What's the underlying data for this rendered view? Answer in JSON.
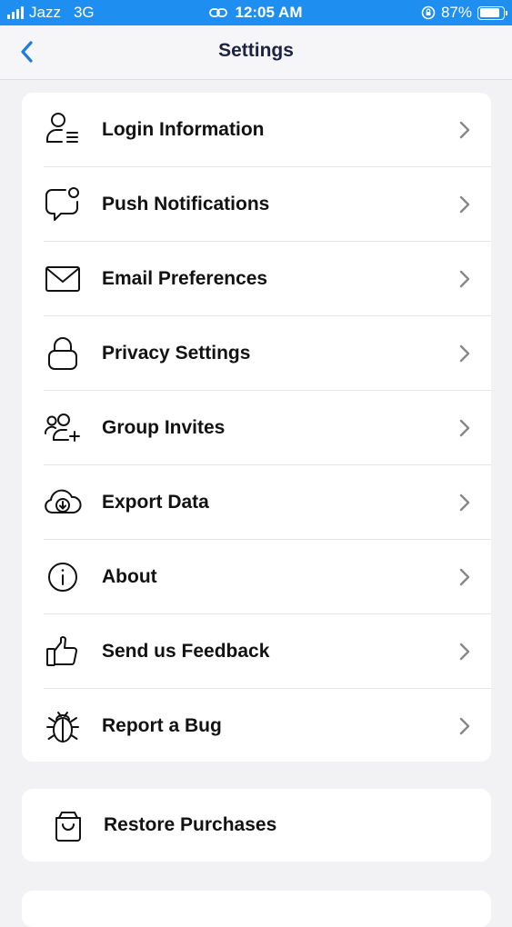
{
  "status_bar": {
    "carrier": "Jazz",
    "network": "3G",
    "time": "12:05 AM",
    "battery": "87%",
    "battery_level": 0.87
  },
  "header": {
    "title": "Settings",
    "back_icon": "chevron-left-icon"
  },
  "menu": {
    "items": [
      {
        "label": "Login Information",
        "icon": "user-list-icon"
      },
      {
        "label": "Push Notifications",
        "icon": "chat-bubble-dot-icon"
      },
      {
        "label": "Email Preferences",
        "icon": "envelope-icon"
      },
      {
        "label": "Privacy Settings",
        "icon": "lock-icon"
      },
      {
        "label": "Group Invites",
        "icon": "user-group-add-icon"
      },
      {
        "label": "Export Data",
        "icon": "cloud-download-icon"
      },
      {
        "label": "About",
        "icon": "info-icon"
      },
      {
        "label": "Send us Feedback",
        "icon": "thumbs-up-icon"
      },
      {
        "label": "Report a Bug",
        "icon": "bug-icon"
      }
    ]
  },
  "restore": {
    "label": "Restore Purchases",
    "icon": "shopping-bag-icon"
  },
  "colors": {
    "status_bar": "#1e8ef0",
    "accent": "#1e7be0",
    "background": "#f2f2f4"
  }
}
